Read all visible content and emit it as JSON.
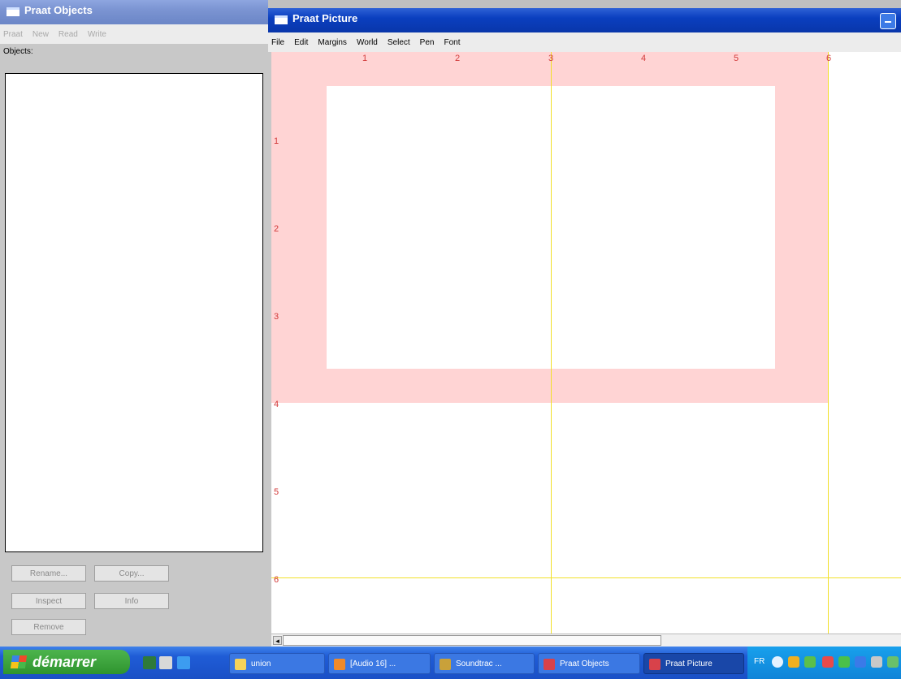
{
  "objects_window": {
    "title": "Praat Objects",
    "menu": [
      "Praat",
      "New",
      "Read",
      "Write"
    ],
    "list_label": "Objects:",
    "buttons": {
      "rename": "Rename...",
      "copy": "Copy...",
      "inspect": "Inspect",
      "info": "Info",
      "remove": "Remove"
    }
  },
  "picture_window": {
    "title": "Praat Picture",
    "menu": [
      "File",
      "Edit",
      "Margins",
      "World",
      "Select",
      "Pen",
      "Font"
    ],
    "ruler_top": [
      "1",
      "2",
      "3",
      "4",
      "5",
      "6"
    ],
    "ruler_left": [
      "1",
      "2",
      "3",
      "4",
      "5",
      "6"
    ]
  },
  "taskbar": {
    "start_label": "démarrer",
    "buttons": [
      {
        "label": "union",
        "active": false
      },
      {
        "label": "[Audio 16] ...",
        "active": false
      },
      {
        "label": "Soundtrac ...",
        "active": false
      },
      {
        "label": "Praat Objects",
        "active": false
      },
      {
        "label": "Praat Picture",
        "active": true
      }
    ],
    "tray_language": "FR"
  },
  "colors": {
    "viewport": "#ffd4d4",
    "ruler": "#d23a3a",
    "selection_lines": "#f2e02a",
    "taskbar": "#1f5cd6",
    "start_button": "#2e942e"
  }
}
